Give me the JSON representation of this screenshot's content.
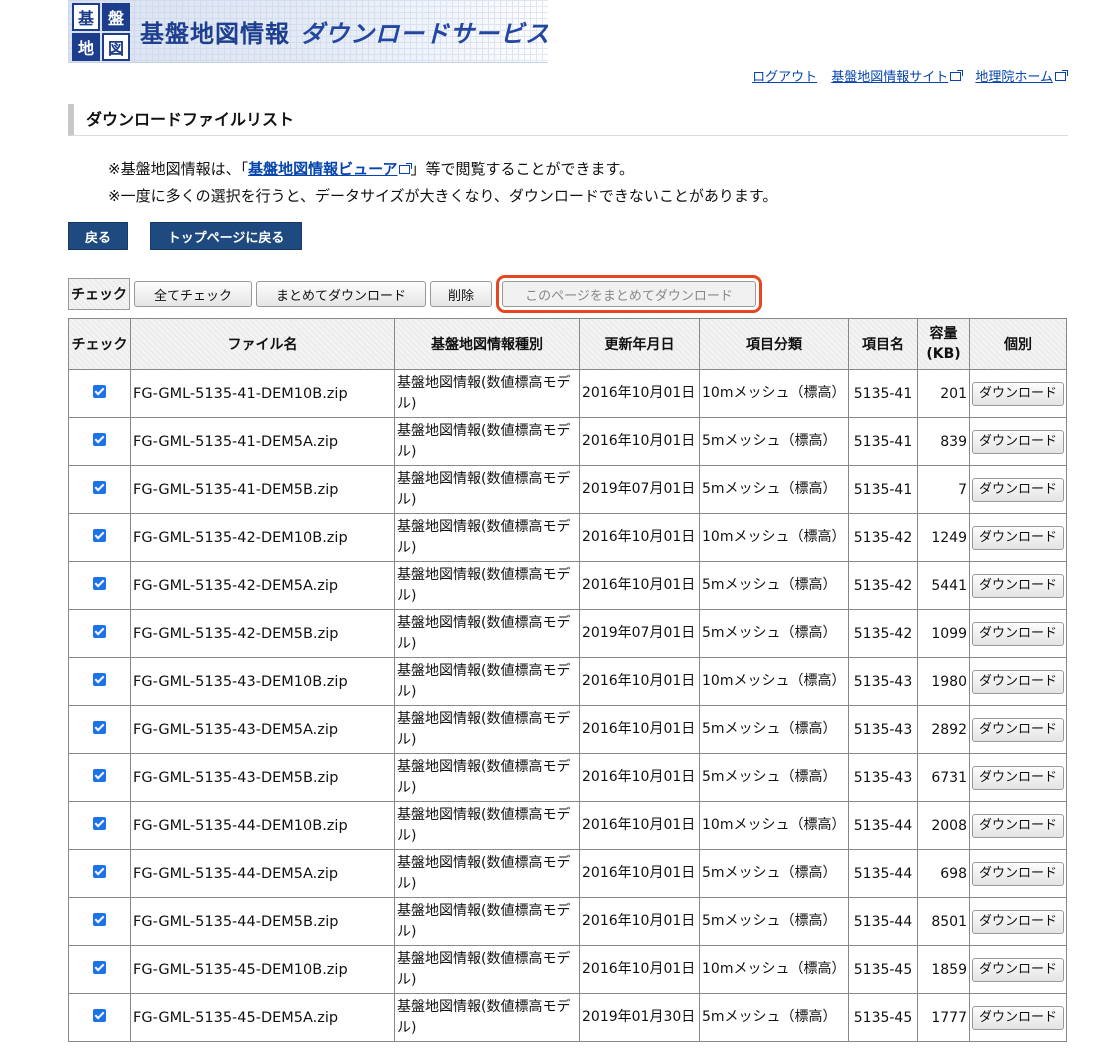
{
  "banner": {
    "logo_chars": [
      "基",
      "盤",
      "地",
      "図",
      "情",
      "報"
    ],
    "title": "基盤地図情報",
    "subtitle": "ダウンロードサービス"
  },
  "top_links": {
    "logout": "ログアウト",
    "kiban_site": "基盤地図情報サイト",
    "gsi_home": "地理院ホーム"
  },
  "section_title": "ダウンロードファイルリスト",
  "notes": {
    "line1_prefix": "※基盤地図情報は、「",
    "line1_link": "基盤地図情報ビューア",
    "line1_suffix": "」等で閲覧することができます。",
    "line2": "※一度に多くの選択を行うと、データサイズが大きくなり、ダウンロードできないことがあります。"
  },
  "nav": {
    "back": "戻る",
    "top": "トップページに戻る"
  },
  "actions": {
    "label": "チェック",
    "check_all": "全てチェック",
    "bulk_download": "まとめてダウンロード",
    "delete": "削除",
    "page_download": "このページをまとめてダウンロード"
  },
  "table": {
    "headers": {
      "check": "チェック",
      "filename": "ファイル名",
      "kind": "基盤地図情報種別",
      "date": "更新年月日",
      "category": "項目分類",
      "item": "項目名",
      "size": "容量(KB)",
      "individual": "個別"
    },
    "download_label": "ダウンロード",
    "rows": [
      {
        "file": "FG-GML-5135-41-DEM10B.zip",
        "kind": "基盤地図情報(数値標高モデル)",
        "date": "2016年10月01日",
        "cat": "10mメッシュ（標高）",
        "item": "5135-41",
        "size": "201"
      },
      {
        "file": "FG-GML-5135-41-DEM5A.zip",
        "kind": "基盤地図情報(数値標高モデル)",
        "date": "2016年10月01日",
        "cat": "5mメッシュ（標高）",
        "item": "5135-41",
        "size": "839"
      },
      {
        "file": "FG-GML-5135-41-DEM5B.zip",
        "kind": "基盤地図情報(数値標高モデル)",
        "date": "2019年07月01日",
        "cat": "5mメッシュ（標高）",
        "item": "5135-41",
        "size": "7"
      },
      {
        "file": "FG-GML-5135-42-DEM10B.zip",
        "kind": "基盤地図情報(数値標高モデル)",
        "date": "2016年10月01日",
        "cat": "10mメッシュ（標高）",
        "item": "5135-42",
        "size": "1249"
      },
      {
        "file": "FG-GML-5135-42-DEM5A.zip",
        "kind": "基盤地図情報(数値標高モデル)",
        "date": "2016年10月01日",
        "cat": "5mメッシュ（標高）",
        "item": "5135-42",
        "size": "5441"
      },
      {
        "file": "FG-GML-5135-42-DEM5B.zip",
        "kind": "基盤地図情報(数値標高モデル)",
        "date": "2019年07月01日",
        "cat": "5mメッシュ（標高）",
        "item": "5135-42",
        "size": "1099"
      },
      {
        "file": "FG-GML-5135-43-DEM10B.zip",
        "kind": "基盤地図情報(数値標高モデル)",
        "date": "2016年10月01日",
        "cat": "10mメッシュ（標高）",
        "item": "5135-43",
        "size": "1980"
      },
      {
        "file": "FG-GML-5135-43-DEM5A.zip",
        "kind": "基盤地図情報(数値標高モデル)",
        "date": "2016年10月01日",
        "cat": "5mメッシュ（標高）",
        "item": "5135-43",
        "size": "2892"
      },
      {
        "file": "FG-GML-5135-43-DEM5B.zip",
        "kind": "基盤地図情報(数値標高モデル)",
        "date": "2016年10月01日",
        "cat": "5mメッシュ（標高）",
        "item": "5135-43",
        "size": "6731"
      },
      {
        "file": "FG-GML-5135-44-DEM10B.zip",
        "kind": "基盤地図情報(数値標高モデル)",
        "date": "2016年10月01日",
        "cat": "10mメッシュ（標高）",
        "item": "5135-44",
        "size": "2008"
      },
      {
        "file": "FG-GML-5135-44-DEM5A.zip",
        "kind": "基盤地図情報(数値標高モデル)",
        "date": "2016年10月01日",
        "cat": "5mメッシュ（標高）",
        "item": "5135-44",
        "size": "698"
      },
      {
        "file": "FG-GML-5135-44-DEM5B.zip",
        "kind": "基盤地図情報(数値標高モデル)",
        "date": "2016年10月01日",
        "cat": "5mメッシュ（標高）",
        "item": "5135-44",
        "size": "8501"
      },
      {
        "file": "FG-GML-5135-45-DEM10B.zip",
        "kind": "基盤地図情報(数値標高モデル)",
        "date": "2016年10月01日",
        "cat": "10mメッシュ（標高）",
        "item": "5135-45",
        "size": "1859"
      },
      {
        "file": "FG-GML-5135-45-DEM5A.zip",
        "kind": "基盤地図情報(数値標高モデル)",
        "date": "2019年01月30日",
        "cat": "5mメッシュ（標高）",
        "item": "5135-45",
        "size": "1777"
      }
    ]
  },
  "colors": {
    "nav_button": "#1f4a80",
    "highlight": "#e8461e",
    "link": "#0645ad"
  }
}
